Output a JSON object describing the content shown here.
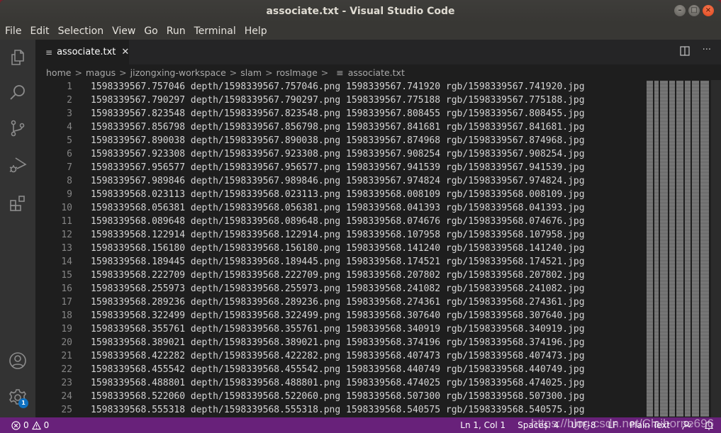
{
  "window": {
    "title": "associate.txt - Visual Studio Code",
    "controls": {
      "minimize": "–",
      "maximize": "□",
      "close": "×"
    }
  },
  "menu": [
    "File",
    "Edit",
    "Selection",
    "View",
    "Go",
    "Run",
    "Terminal",
    "Help"
  ],
  "activity_bar": {
    "items": [
      "explorer-icon",
      "search-icon",
      "source-control-icon",
      "run-debug-icon",
      "extensions-icon"
    ],
    "bottom": [
      "account-icon",
      "settings-gear-icon"
    ],
    "settings_badge": "1"
  },
  "tabs": [
    {
      "label": "associate.txt",
      "icon": "text-file-icon",
      "active": true,
      "close": "✕"
    }
  ],
  "tab_actions": {
    "split": "split-editor-icon",
    "more": "···"
  },
  "breadcrumb": {
    "items": [
      "home",
      "magus",
      "jizongxing-workspace",
      "slam",
      "rosImage"
    ],
    "separator": ">",
    "file": "associate.txt",
    "file_icon": "≡"
  },
  "editor": {
    "lines": [
      {
        "n": "1",
        "text": "1598339567.757046 depth/1598339567.757046.png 1598339567.741920 rgb/1598339567.741920.jpg"
      },
      {
        "n": "2",
        "text": "1598339567.790297 depth/1598339567.790297.png 1598339567.775188 rgb/1598339567.775188.jpg"
      },
      {
        "n": "3",
        "text": "1598339567.823548 depth/1598339567.823548.png 1598339567.808455 rgb/1598339567.808455.jpg"
      },
      {
        "n": "4",
        "text": "1598339567.856798 depth/1598339567.856798.png 1598339567.841681 rgb/1598339567.841681.jpg"
      },
      {
        "n": "5",
        "text": "1598339567.890038 depth/1598339567.890038.png 1598339567.874968 rgb/1598339567.874968.jpg"
      },
      {
        "n": "6",
        "text": "1598339567.923308 depth/1598339567.923308.png 1598339567.908254 rgb/1598339567.908254.jpg"
      },
      {
        "n": "7",
        "text": "1598339567.956577 depth/1598339567.956577.png 1598339567.941539 rgb/1598339567.941539.jpg"
      },
      {
        "n": "8",
        "text": "1598339567.989846 depth/1598339567.989846.png 1598339567.974824 rgb/1598339567.974824.jpg"
      },
      {
        "n": "9",
        "text": "1598339568.023113 depth/1598339568.023113.png 1598339568.008109 rgb/1598339568.008109.jpg"
      },
      {
        "n": "10",
        "text": "1598339568.056381 depth/1598339568.056381.png 1598339568.041393 rgb/1598339568.041393.jpg"
      },
      {
        "n": "11",
        "text": "1598339568.089648 depth/1598339568.089648.png 1598339568.074676 rgb/1598339568.074676.jpg"
      },
      {
        "n": "12",
        "text": "1598339568.122914 depth/1598339568.122914.png 1598339568.107958 rgb/1598339568.107958.jpg"
      },
      {
        "n": "13",
        "text": "1598339568.156180 depth/1598339568.156180.png 1598339568.141240 rgb/1598339568.141240.jpg"
      },
      {
        "n": "14",
        "text": "1598339568.189445 depth/1598339568.189445.png 1598339568.174521 rgb/1598339568.174521.jpg"
      },
      {
        "n": "15",
        "text": "1598339568.222709 depth/1598339568.222709.png 1598339568.207802 rgb/1598339568.207802.jpg"
      },
      {
        "n": "16",
        "text": "1598339568.255973 depth/1598339568.255973.png 1598339568.241082 rgb/1598339568.241082.jpg"
      },
      {
        "n": "17",
        "text": "1598339568.289236 depth/1598339568.289236.png 1598339568.274361 rgb/1598339568.274361.jpg"
      },
      {
        "n": "18",
        "text": "1598339568.322499 depth/1598339568.322499.png 1598339568.307640 rgb/1598339568.307640.jpg"
      },
      {
        "n": "19",
        "text": "1598339568.355761 depth/1598339568.355761.png 1598339568.340919 rgb/1598339568.340919.jpg"
      },
      {
        "n": "20",
        "text": "1598339568.389021 depth/1598339568.389021.png 1598339568.374196 rgb/1598339568.374196.jpg"
      },
      {
        "n": "21",
        "text": "1598339568.422282 depth/1598339568.422282.png 1598339568.407473 rgb/1598339568.407473.jpg"
      },
      {
        "n": "22",
        "text": "1598339568.455542 depth/1598339568.455542.png 1598339568.440749 rgb/1598339568.440749.jpg"
      },
      {
        "n": "23",
        "text": "1598339568.488801 depth/1598339568.488801.png 1598339568.474025 rgb/1598339568.474025.jpg"
      },
      {
        "n": "24",
        "text": "1598339568.522060 depth/1598339568.522060.png 1598339568.507300 rgb/1598339568.507300.jpg"
      },
      {
        "n": "25",
        "text": "1598339568.555318 depth/1598339568.555318.png 1598339568.540575 rgb/1598339568.540575.jpg"
      }
    ]
  },
  "status_bar": {
    "errors": "0",
    "warnings": "0",
    "cursor": "Ln 1, Col 1",
    "indent": "Spaces: 4",
    "encoding": "UTF-8",
    "eol": "LF",
    "language": "Plain Text",
    "feedback_icon": "feedback-icon",
    "notifications_icon": "bell-icon",
    "color": "#68217a"
  },
  "watermark": "https://blog.csdn.net/Claiborne696"
}
